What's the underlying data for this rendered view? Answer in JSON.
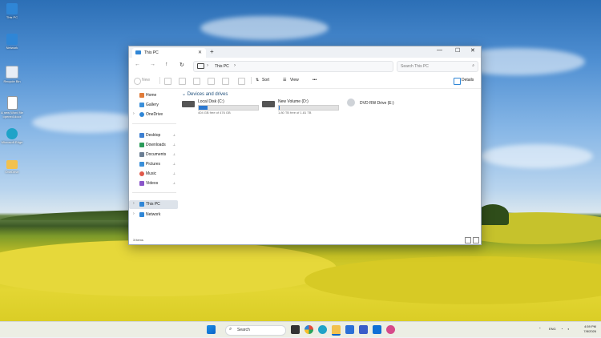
{
  "desktop_icons": [
    {
      "label": "This PC",
      "icon": "this-pc-icon",
      "color": "#2f86d6"
    },
    {
      "label": "Network",
      "icon": "network-icon",
      "color": "#2f86d6"
    },
    {
      "label": "Recycle Bin",
      "icon": "recycle-bin-icon",
      "color": "#e8eef6"
    },
    {
      "label": "A new Word file opened.docx",
      "icon": "document-icon",
      "color": "#ffffff"
    },
    {
      "label": "Microsoft Edge",
      "icon": "edge-icon",
      "color": "#1fa3c8"
    },
    {
      "label": "OneDrive",
      "icon": "folder-icon",
      "color": "#f2c14e"
    }
  ],
  "window": {
    "tab_title": "This PC",
    "tab_close": "✕",
    "new_tab": "+",
    "minimize": "—",
    "maximize": "☐",
    "close": "✕"
  },
  "address": {
    "nav_back": "←",
    "nav_forward": "→",
    "nav_up": "↑",
    "nav_refresh": "↻",
    "separator": "›",
    "crumb": "This PC",
    "search_placeholder": "Search This PC"
  },
  "command_bar": {
    "new_label": "New",
    "sort_label": "Sort",
    "view_label": "View",
    "more_label": "•••",
    "details_label": "Details"
  },
  "nav_pane": {
    "pin_glyph": "⊥",
    "chevron": "›",
    "items": [
      {
        "label": "Home",
        "icon": "home-icon",
        "color": "#e07b39",
        "pinned": false
      },
      {
        "label": "Gallery",
        "icon": "gallery-icon",
        "color": "#3a8fd9",
        "pinned": false
      },
      {
        "label": "OneDrive",
        "icon": "onedrive-icon",
        "color": "#2f86d6",
        "pinned": false
      },
      {
        "label": "Desktop",
        "icon": "desktop-icon",
        "color": "#3d7fd1",
        "pinned": true
      },
      {
        "label": "Downloads",
        "icon": "downloads-icon",
        "color": "#2a9b59",
        "pinned": true
      },
      {
        "label": "Documents",
        "icon": "documents-icon",
        "color": "#6b7e93",
        "pinned": true
      },
      {
        "label": "Pictures",
        "icon": "pictures-icon",
        "color": "#3a8fd9",
        "pinned": true
      },
      {
        "label": "Music",
        "icon": "music-icon",
        "color": "#e0584a",
        "pinned": true
      },
      {
        "label": "Videos",
        "icon": "videos-icon",
        "color": "#8a55c9",
        "pinned": true
      },
      {
        "label": "This PC",
        "icon": "this-pc-icon",
        "color": "#2f86d6",
        "pinned": false
      },
      {
        "label": "Network",
        "icon": "network-icon",
        "color": "#2f86d6",
        "pinned": false
      }
    ]
  },
  "content": {
    "group_label": "Devices and drives",
    "drives": [
      {
        "name": "Local Disk (C:)",
        "free_text": "404 GB free of 476 GB",
        "used_fraction": 0.15,
        "icon": "windows-drive-icon"
      },
      {
        "name": "New Volume (D:)",
        "free_text": "1.80 TB free of 1.81 TB",
        "used_fraction": 0.01,
        "icon": "drive-icon"
      },
      {
        "name": "DVD RW Drive (E:)",
        "icon": "dvd-drive-icon"
      }
    ]
  },
  "status_bar": {
    "item_count": "3 items"
  },
  "taskbar": {
    "search_label": "Search",
    "lang": "ENG",
    "time": "4:59 PM",
    "date": "7/8/2026",
    "accent": "#0a64c8"
  }
}
